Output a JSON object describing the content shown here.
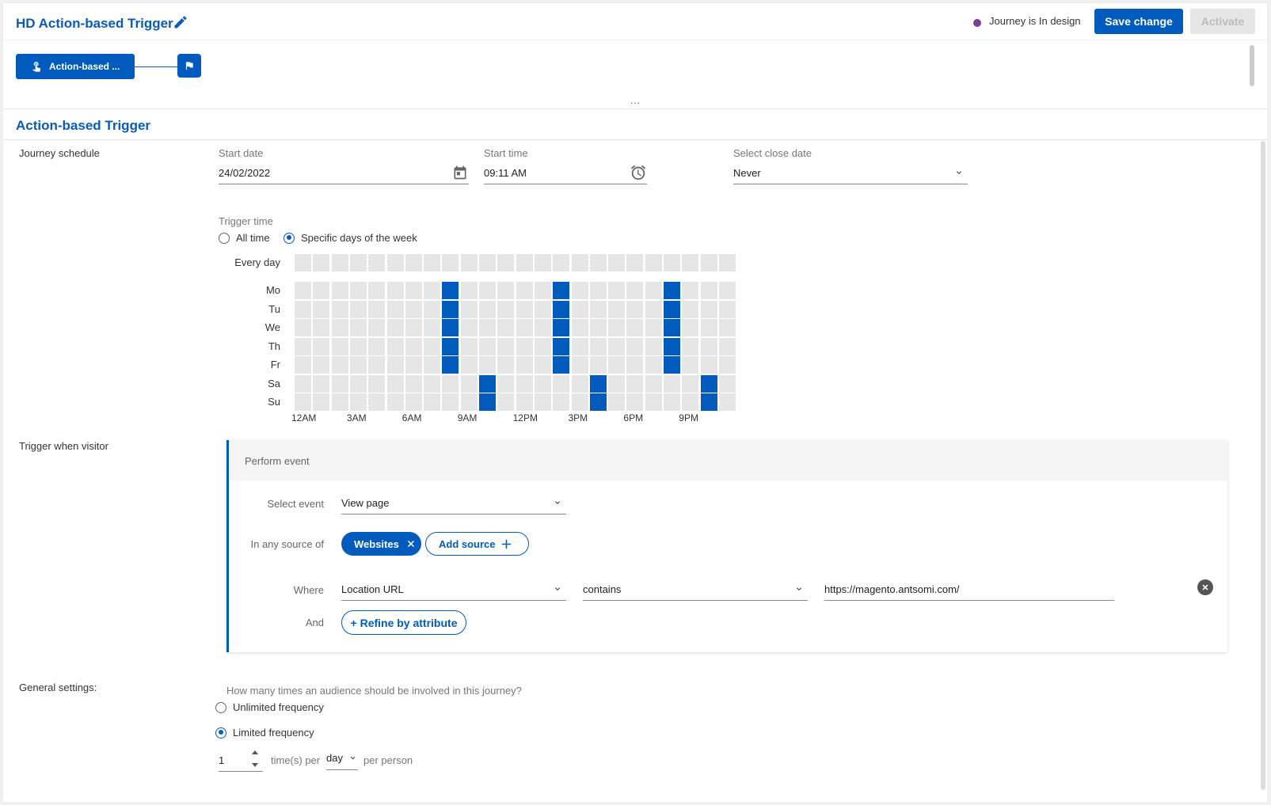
{
  "header": {
    "title": "HD Action-based Trigger",
    "status_text": "Journey is In design",
    "status_color": "#7d3c98",
    "save_label": "Save change",
    "activate_label": "Activate",
    "accent_color": "#005bbd"
  },
  "flow": {
    "node_label": "Action-based ...",
    "node_icon": "touch-hand-icon",
    "end_icon": "flag-icon",
    "collapse_dots": "..."
  },
  "section": {
    "title": "Action-based Trigger"
  },
  "schedule": {
    "label": "Journey schedule",
    "start_date_label": "Start date",
    "start_date_value": "24/02/2022",
    "start_time_label": "Start time",
    "start_time_value": "09:11 AM",
    "close_date_label": "Select close date",
    "close_date_value": "Never",
    "trigger_time_label": "Trigger time",
    "option_all_time": "All time",
    "option_specific_days": "Specific days of the week",
    "selected_option": "specific",
    "every_day_label": "Every day",
    "days": [
      "Mo",
      "Tu",
      "We",
      "Th",
      "Fr",
      "Sa",
      "Su"
    ],
    "hour_labels": [
      "12AM",
      "3AM",
      "6AM",
      "9AM",
      "12PM",
      "3PM",
      "6PM",
      "9PM"
    ],
    "selected_hours": {
      "Mo": [
        8,
        14,
        20
      ],
      "Tu": [
        8,
        14,
        20
      ],
      "We": [
        8,
        14,
        20
      ],
      "Th": [
        8,
        14,
        20
      ],
      "Fr": [
        8,
        14,
        20
      ],
      "Sa": [
        10,
        16,
        22
      ],
      "Su": [
        10,
        16,
        22
      ]
    }
  },
  "trigger": {
    "label": "Trigger when visitor",
    "panel_title": "Perform event",
    "select_event_label": "Select event",
    "select_event_value": "View page",
    "source_label": "In any source of",
    "source_chip": "Websites",
    "add_source_label": "Add source",
    "where_label": "Where",
    "attribute_value": "Location URL",
    "operator_value": "contains",
    "url_value": "https://magento.antsomi.com/",
    "and_label": "And",
    "refine_label": "+ Refine by attribute"
  },
  "general": {
    "label": "General settings:",
    "question": "How many times an audience should be involved in this journey?",
    "option_unlimited": "Unlimited frequency",
    "option_limited": "Limited frequency",
    "selected_option": "limited",
    "times_value": "1",
    "times_per_label": "time(s) per",
    "period_value": "day",
    "per_person_label": "per person"
  }
}
